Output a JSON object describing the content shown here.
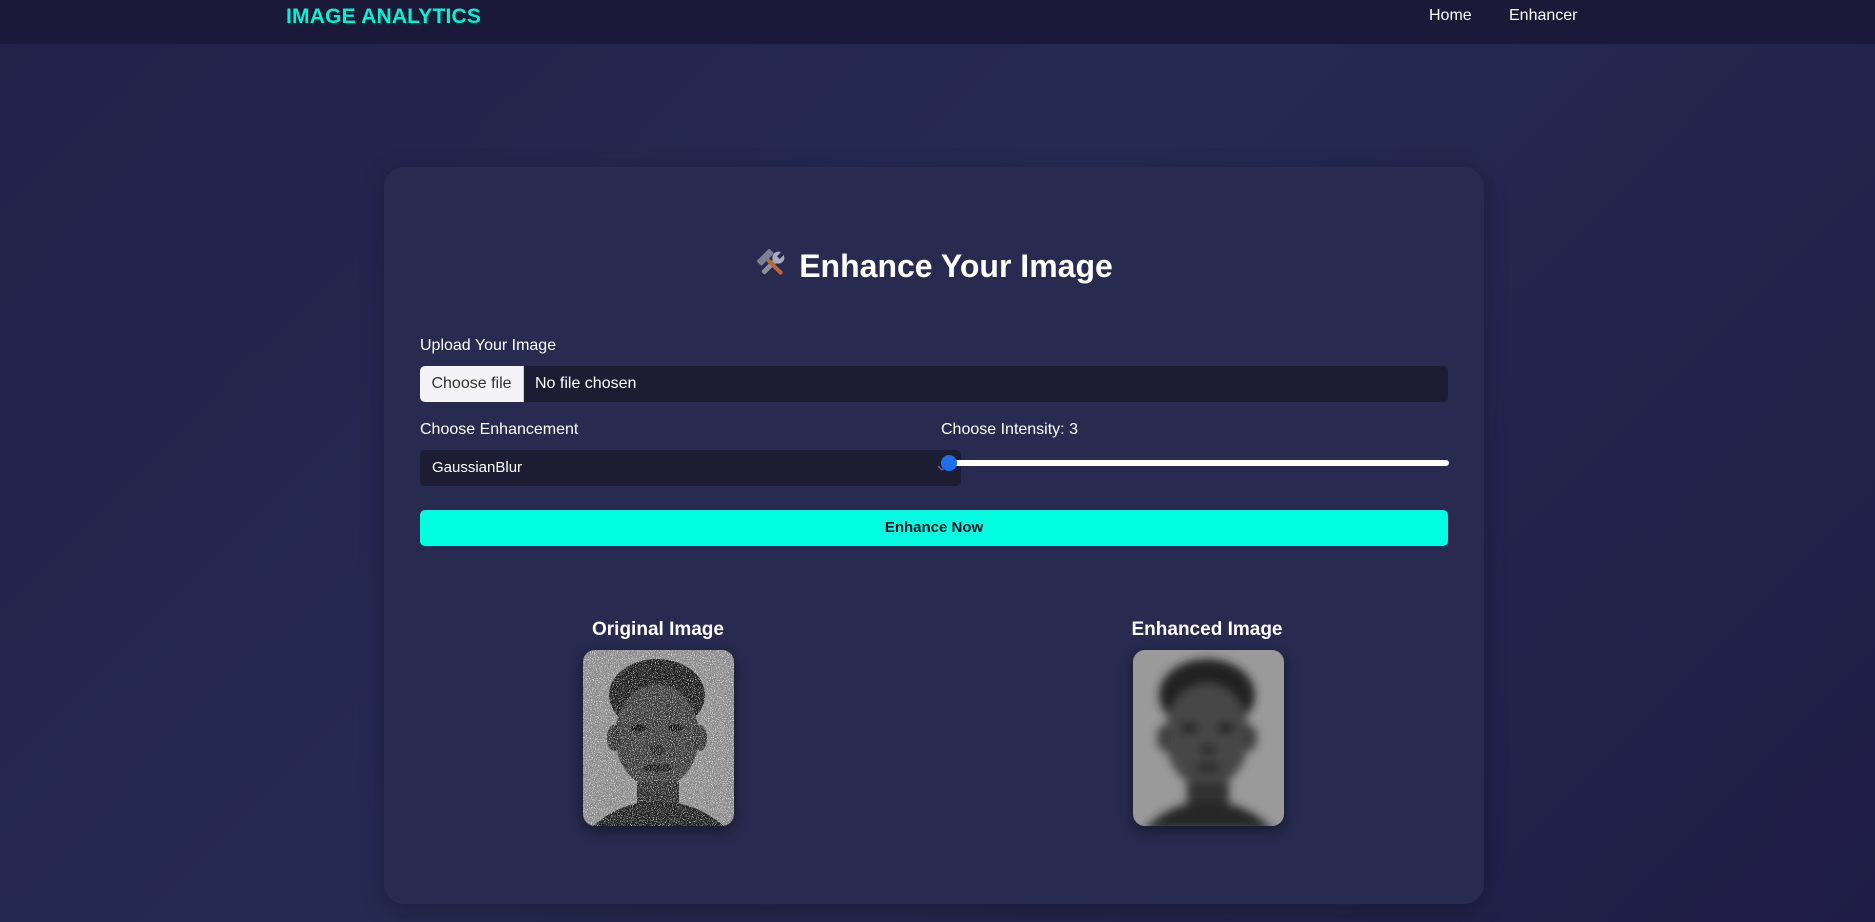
{
  "navbar": {
    "brand": "IMAGE ANALYTICS",
    "links": [
      "Home",
      "Enhancer"
    ]
  },
  "card": {
    "title": "Enhance Your Image",
    "title_icon": "tools-icon",
    "upload": {
      "label": "Upload Your Image",
      "button_label": "Choose file",
      "status": "No file chosen"
    },
    "enhancement": {
      "label": "Choose Enhancement",
      "selected": "GaussianBlur"
    },
    "intensity": {
      "label": "Choose Intensity: 3",
      "value": 3
    },
    "submit_label": "Enhance Now",
    "original_caption": "Original Image",
    "enhanced_caption": "Enhanced Image"
  },
  "colors": {
    "accent": "#00f5d4",
    "button": "#00ffe0",
    "slider_thumb": "#1e6ff0",
    "background": "#22214b",
    "card": "#282a50"
  }
}
